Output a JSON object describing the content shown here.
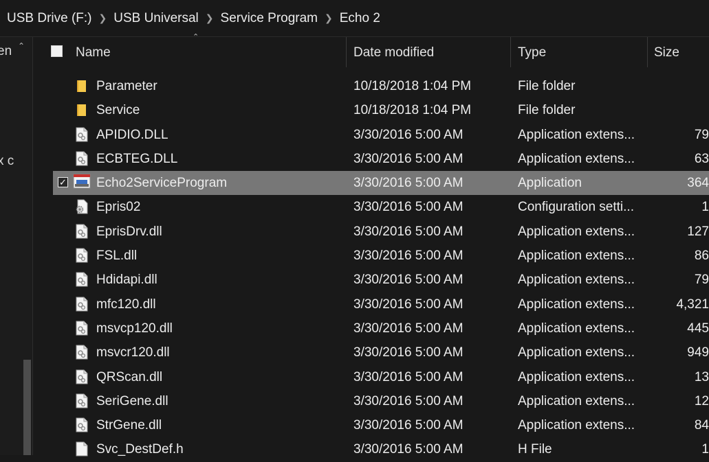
{
  "breadcrumb": [
    "USB Drive (F:)",
    "USB Universal",
    "Service Program",
    "Echo 2"
  ],
  "nav_pane": {
    "text_top": "en",
    "text_mid": "x c"
  },
  "columns": {
    "name": "Name",
    "date": "Date modified",
    "type": "Type",
    "size": "Size"
  },
  "files": [
    {
      "name": "Parameter",
      "date": "10/18/2018 1:04 PM",
      "type": "File folder",
      "size": "",
      "icon": "folder-icon"
    },
    {
      "name": "Service",
      "date": "10/18/2018 1:04 PM",
      "type": "File folder",
      "size": "",
      "icon": "folder-icon"
    },
    {
      "name": "APIDIO.DLL",
      "date": "3/30/2016 5:00 AM",
      "type": "Application extens...",
      "size": "79",
      "icon": "dll-file-icon"
    },
    {
      "name": "ECBTEG.DLL",
      "date": "3/30/2016 5:00 AM",
      "type": "Application extens...",
      "size": "63",
      "icon": "dll-file-icon"
    },
    {
      "name": "Echo2ServiceProgram",
      "date": "3/30/2016 5:00 AM",
      "type": "Application",
      "size": "364",
      "icon": "application-icon",
      "selected": true
    },
    {
      "name": "Epris02",
      "date": "3/30/2016 5:00 AM",
      "type": "Configuration setti...",
      "size": "1",
      "icon": "config-file-icon"
    },
    {
      "name": "EprisDrv.dll",
      "date": "3/30/2016 5:00 AM",
      "type": "Application extens...",
      "size": "127",
      "icon": "dll-file-icon"
    },
    {
      "name": "FSL.dll",
      "date": "3/30/2016 5:00 AM",
      "type": "Application extens...",
      "size": "86",
      "icon": "dll-file-icon"
    },
    {
      "name": "Hdidapi.dll",
      "date": "3/30/2016 5:00 AM",
      "type": "Application extens...",
      "size": "79",
      "icon": "dll-file-icon"
    },
    {
      "name": "mfc120.dll",
      "date": "3/30/2016 5:00 AM",
      "type": "Application extens...",
      "size": "4,321",
      "icon": "dll-file-icon"
    },
    {
      "name": "msvcp120.dll",
      "date": "3/30/2016 5:00 AM",
      "type": "Application extens...",
      "size": "445",
      "icon": "dll-file-icon"
    },
    {
      "name": "msvcr120.dll",
      "date": "3/30/2016 5:00 AM",
      "type": "Application extens...",
      "size": "949",
      "icon": "dll-file-icon"
    },
    {
      "name": "QRScan.dll",
      "date": "3/30/2016 5:00 AM",
      "type": "Application extens...",
      "size": "13",
      "icon": "dll-file-icon"
    },
    {
      "name": "SeriGene.dll",
      "date": "3/30/2016 5:00 AM",
      "type": "Application extens...",
      "size": "12",
      "icon": "dll-file-icon"
    },
    {
      "name": "StrGene.dll",
      "date": "3/30/2016 5:00 AM",
      "type": "Application extens...",
      "size": "84",
      "icon": "dll-file-icon"
    },
    {
      "name": "Svc_DestDef.h",
      "date": "3/30/2016 5:00 AM",
      "type": "H File",
      "size": "1",
      "icon": "text-file-icon"
    }
  ],
  "colors": {
    "background": "#191919",
    "selected_row": "#777777",
    "folder": "#f1c232",
    "text": "#ededed"
  }
}
